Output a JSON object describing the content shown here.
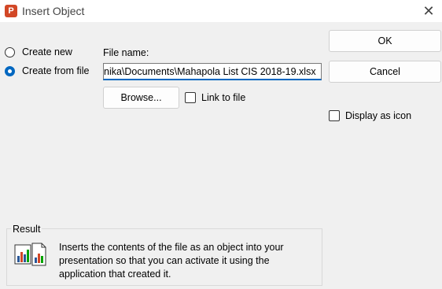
{
  "window": {
    "title": "Insert Object",
    "app_icon_letter": "P",
    "icon": "powerpoint-icon",
    "close_glyph": "✕"
  },
  "options": {
    "create_new_label": "Create new",
    "create_from_file_label": "Create from file",
    "selected": "create_from_file"
  },
  "file": {
    "label": "File name:",
    "value": "nika\\Documents\\Mahapola List CIS 2018-19.xlsx",
    "browse_label": "Browse...",
    "link_label": "Link to file",
    "link_checked": false
  },
  "buttons": {
    "ok_label": "OK",
    "cancel_label": "Cancel"
  },
  "display_as_icon": {
    "label": "Display as icon",
    "checked": false
  },
  "result": {
    "title": "Result",
    "icon": "embedded-object-icon",
    "text": "Inserts the contents of the file as an object into your presentation so that you can activate it using the application that created it."
  },
  "colors": {
    "accent": "#0067c0",
    "app_brand": "#d24726"
  }
}
